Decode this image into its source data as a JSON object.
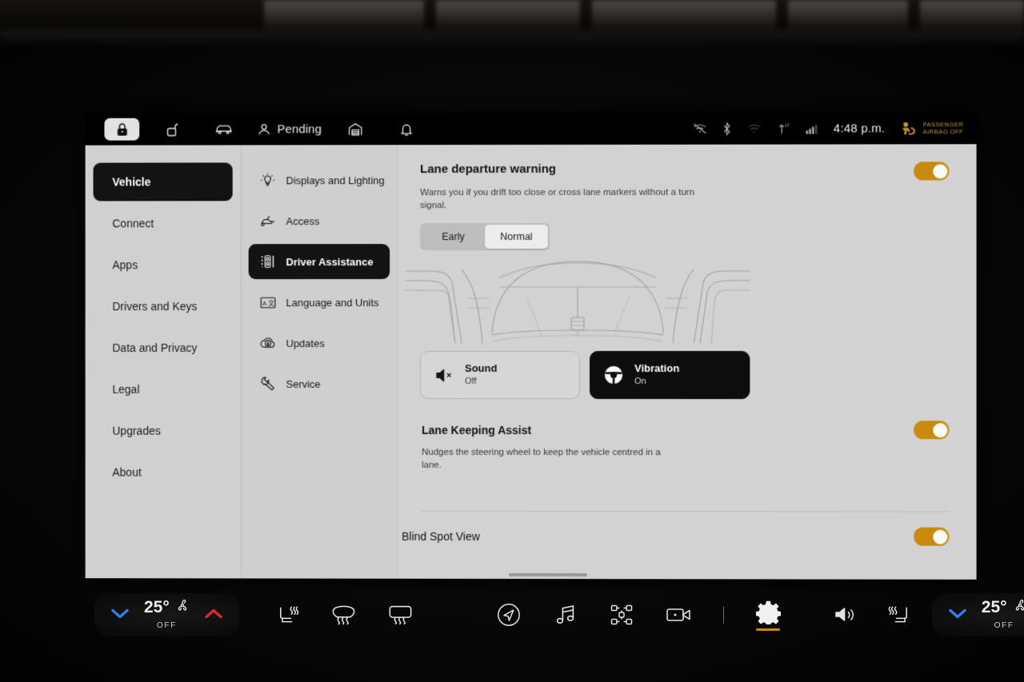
{
  "statusbar": {
    "left_icons": [
      {
        "name": "lock-locked-icon",
        "active": true
      },
      {
        "name": "lock-unlocked-icon",
        "active": false
      },
      {
        "name": "car-icon",
        "active": false
      }
    ],
    "pending_label": "Pending",
    "right_icons": [
      {
        "name": "wifi-off-icon"
      },
      {
        "name": "bluetooth-icon"
      },
      {
        "name": "wifi-icon"
      },
      {
        "name": "lte-antenna-icon"
      },
      {
        "name": "signal-bars-icon"
      }
    ],
    "time": "4:48 p.m.",
    "airbag_line1": "PASSENGER",
    "airbag_line2": "AIRBAG",
    "airbag_state": "OFF"
  },
  "sidebar_primary": {
    "items": [
      {
        "label": "Vehicle",
        "active": true
      },
      {
        "label": "Connect",
        "active": false
      },
      {
        "label": "Apps",
        "active": false
      },
      {
        "label": "Drivers and Keys",
        "active": false
      },
      {
        "label": "Data and Privacy",
        "active": false
      },
      {
        "label": "Legal",
        "active": false
      },
      {
        "label": "Upgrades",
        "active": false
      },
      {
        "label": "About",
        "active": false
      }
    ]
  },
  "sidebar_secondary": {
    "items": [
      {
        "label": "Displays and Lighting",
        "icon": "lightbulb-icon",
        "active": false
      },
      {
        "label": "Access",
        "icon": "car-access-icon",
        "active": false
      },
      {
        "label": "Driver Assistance",
        "icon": "driver-assistance-icon",
        "active": true
      },
      {
        "label": "Language and Units",
        "icon": "translate-icon",
        "active": false
      },
      {
        "label": "Updates",
        "icon": "cloud-download-icon",
        "active": false
      },
      {
        "label": "Service",
        "icon": "wrench-icon",
        "active": false
      }
    ]
  },
  "content": {
    "lane_departure": {
      "title": "Lane departure warning",
      "description": "Warns you if you drift too close or cross lane markers without a turn signal.",
      "toggle_on": true,
      "segments": [
        {
          "label": "Early",
          "selected": false
        },
        {
          "label": "Normal",
          "selected": true
        }
      ]
    },
    "alert_cards": [
      {
        "title": "Sound",
        "state": "Off",
        "icon": "speaker-mute-icon",
        "active": false
      },
      {
        "title": "Vibration",
        "state": "On",
        "icon": "steering-wheel-icon",
        "active": true
      }
    ],
    "lane_keeping_assist": {
      "title": "Lane Keeping Assist",
      "description": "Nudges the steering wheel to keep the vehicle centred in a lane.",
      "toggle_on": true
    },
    "blind_spot_view": {
      "title": "Blind Spot View",
      "toggle_on": true
    }
  },
  "dock": {
    "driver_climate": {
      "temperature": "25°",
      "state": "OFF",
      "fan_icon": "fan-icon",
      "down_icon": "chevron-down-icon",
      "up_icon": "chevron-up-icon"
    },
    "passenger_climate": {
      "temperature": "25°",
      "state": "OFF",
      "fan_icon": "fan-icon",
      "down_icon": "chevron-down-icon",
      "up_icon": "chevron-up-icon"
    },
    "left_buttons": [
      {
        "name": "driver-seat-heater-icon"
      },
      {
        "name": "front-defrost-icon"
      },
      {
        "name": "rear-defrost-icon"
      }
    ],
    "center_buttons": [
      {
        "name": "navigation-icon",
        "active": false
      },
      {
        "name": "music-icon",
        "active": false
      },
      {
        "name": "tire-pressure-icon",
        "active": false
      },
      {
        "name": "camera-icon",
        "active": false
      },
      {
        "name": "settings-gear-icon",
        "active": true
      }
    ],
    "right_buttons": [
      {
        "name": "volume-icon"
      },
      {
        "name": "passenger-seat-heater-icon"
      }
    ]
  },
  "colors": {
    "accent": "#c98a0e",
    "panel_bg": "#d1d1d1",
    "active_bg": "#131313",
    "cool": "#2f7ff0",
    "warm": "#d62b2b"
  }
}
